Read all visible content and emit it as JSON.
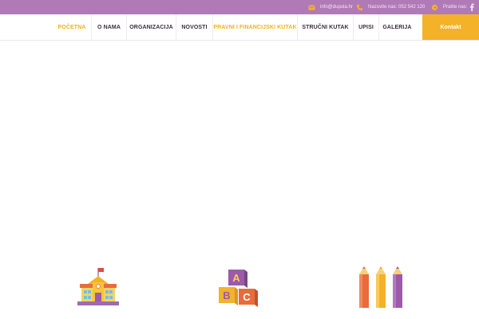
{
  "topbar": {
    "email": "info@dupula.hr",
    "phone": "Nazovite nas: 052 542 120",
    "follow": "Pratite nas:",
    "background": "#b07ab6",
    "icon_color": "#f4b229"
  },
  "nav": {
    "items": [
      {
        "label": "POČETNA",
        "active": true
      },
      {
        "label": "O NAMA",
        "active": false
      },
      {
        "label": "ORGANIZACIJA",
        "active": false
      },
      {
        "label": "NOVOSTI",
        "active": false
      },
      {
        "label": "PRAVNI I FINANCIJSKI KUTAK",
        "active": true
      },
      {
        "label": "STRUČNI KUTAK",
        "active": false
      },
      {
        "label": "UPISI",
        "active": false
      },
      {
        "label": "GALERIJA",
        "active": false
      }
    ],
    "contact_label": "Kontakt",
    "accent": "#f4b229"
  },
  "features": [
    {
      "icon": "school-building-icon"
    },
    {
      "icon": "abc-blocks-icon",
      "letters": [
        "A",
        "B",
        "C"
      ]
    },
    {
      "icon": "pencils-icon"
    }
  ]
}
